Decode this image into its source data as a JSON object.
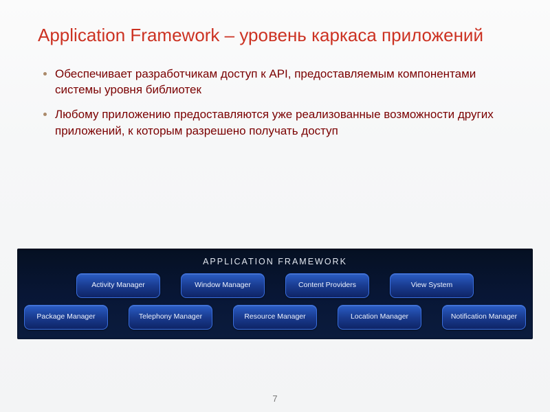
{
  "slide": {
    "title": "Application Framework – уровень каркаса приложений",
    "bullets": [
      "Обеспечивает разработчикам доступ к API, предоставляемым компонентами системы уровня библиотек",
      "Любому приложению предоставляются уже реализованные возможности других приложений, к которым разрешено получать доступ"
    ],
    "page_number": "7"
  },
  "framework": {
    "title": "Application Framework",
    "rows": [
      [
        "Activity Manager",
        "Window Manager",
        "Content Providers",
        "View System"
      ],
      [
        "Package Manager",
        "Telephony Manager",
        "Resource Manager",
        "Location Manager",
        "Notification Manager"
      ]
    ]
  }
}
